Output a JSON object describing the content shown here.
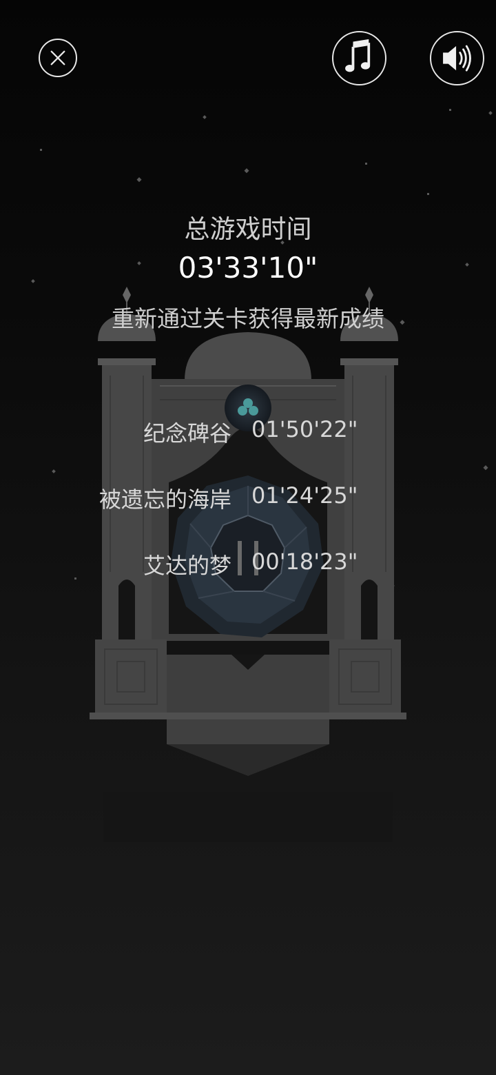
{
  "header": {
    "close_icon": "close-circle-icon",
    "music_icon": "music-note-icon",
    "sound_icon": "speaker-sound-icon"
  },
  "summary": {
    "total_label": "总游戏时间",
    "total_time": "03'33'10\"",
    "hint": "重新通过关卡获得最新成绩"
  },
  "levels": [
    {
      "name": "纪念碑谷",
      "time": "01'50'22\""
    },
    {
      "name": "被遗忘的海岸",
      "time": "01'24'25\""
    },
    {
      "name": "艾达的梦",
      "time": "00'18'23\""
    }
  ],
  "colors": {
    "background": "#0d0d0d",
    "text": "#d8d8d8",
    "monument": "#444444",
    "gem_teal": "#4a9a9a"
  }
}
